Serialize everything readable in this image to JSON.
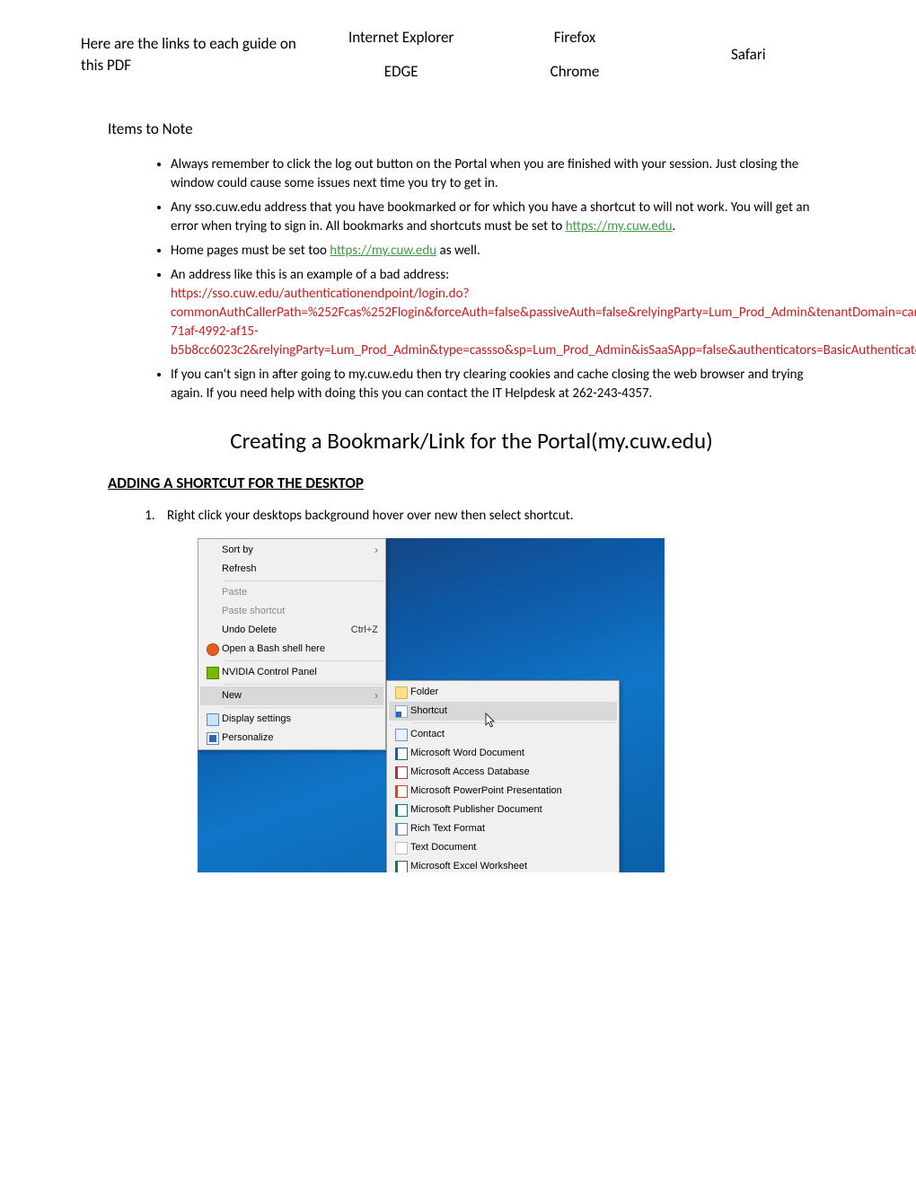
{
  "topNav": {
    "intro": "Here are the links to each guide on this PDF",
    "col1": {
      "top": "Internet Explorer",
      "bottom": "EDGE"
    },
    "col2": {
      "top": "Firefox",
      "bottom": "Chrome"
    },
    "col3": {
      "top": "Safari"
    }
  },
  "itemsToNote": {
    "heading": "Items to Note",
    "bullets": {
      "b1": "Always remember to click the log out button on the Portal when you are finished with your session.  Just closing the window could cause some issues next time you try to get in.",
      "b2_pre": "Any sso.cuw.edu address that you have bookmarked or for which you have a shortcut to will not work. You will get an error when trying to sign in.  All bookmarks and shortcuts must be set to ",
      "b2_link": "https://my.cuw.edu",
      "b2_post": ".",
      "b3_pre": "Home pages must be set too ",
      "b3_link": "https://my.cuw.edu",
      "b3_post": " as well.",
      "b4_pre": "An address like this is an example of a bad address:",
      "b4_red": "https://sso.cuw.edu/authenticationendpoint/login.do?commonAuthCallerPath=%252Fcas%252Flogin&forceAuth=false&passiveAuth=false&relyingParty=Lum_Prod_Admin&tenantDomain=carbon.super&type=cassso&sessionDataKey=e65565ea-71af-4992-af15-b5b8cc6023c2&relyingParty=Lum_Prod_Admin&type=cassso&sp=Lum_Prod_Admin&isSaaSApp=false&authenticators=BasicAuthenticator:LOCAL",
      "b5": "If you can't sign in after going to my.cuw.edu then try clearing cookies and cache closing the web browser and trying again.  If you need help with doing this you can contact the IT Helpdesk at 262-243-4357."
    }
  },
  "pageTitle": "Creating a Bookmark/Link for the Portal(my.cuw.edu)",
  "shortcutSection": {
    "heading": "ADDING A SHORTCUT FOR THE DESKTOP",
    "step1": "Right click your desktops background hover over new then select shortcut."
  },
  "contextMenu": {
    "primary": [
      {
        "label": "Sort by",
        "submenu": true
      },
      {
        "label": "Refresh"
      },
      {
        "sep": true
      },
      {
        "label": "Paste",
        "disabled": true
      },
      {
        "label": "Paste shortcut",
        "disabled": true
      },
      {
        "label": "Undo Delete",
        "shortcut": "Ctrl+Z"
      },
      {
        "label": "Open a Bash shell here",
        "icon": "bash"
      },
      {
        "sep": true
      },
      {
        "label": "NVIDIA Control Panel",
        "icon": "nvidia"
      },
      {
        "sep": true
      },
      {
        "label": "New",
        "submenu": true,
        "highlight": true
      },
      {
        "sep": true
      },
      {
        "label": "Display settings",
        "icon": "display"
      },
      {
        "label": "Personalize",
        "icon": "personalize"
      }
    ],
    "secondary": [
      {
        "label": "Folder",
        "icon": "folder"
      },
      {
        "label": "Shortcut",
        "icon": "shortcut-file",
        "highlight": true
      },
      {
        "sep": true
      },
      {
        "label": "Contact",
        "icon": "contact"
      },
      {
        "label": "Microsoft Word Document",
        "icon": "word"
      },
      {
        "label": "Microsoft Access Database",
        "icon": "access"
      },
      {
        "label": "Microsoft PowerPoint Presentation",
        "icon": "ppt"
      },
      {
        "label": "Microsoft Publisher Document",
        "icon": "publisher"
      },
      {
        "label": "Rich Text Format",
        "icon": "rtf"
      },
      {
        "label": "Text Document",
        "icon": "txt"
      },
      {
        "label": "Microsoft Excel Worksheet",
        "icon": "excel"
      }
    ]
  }
}
